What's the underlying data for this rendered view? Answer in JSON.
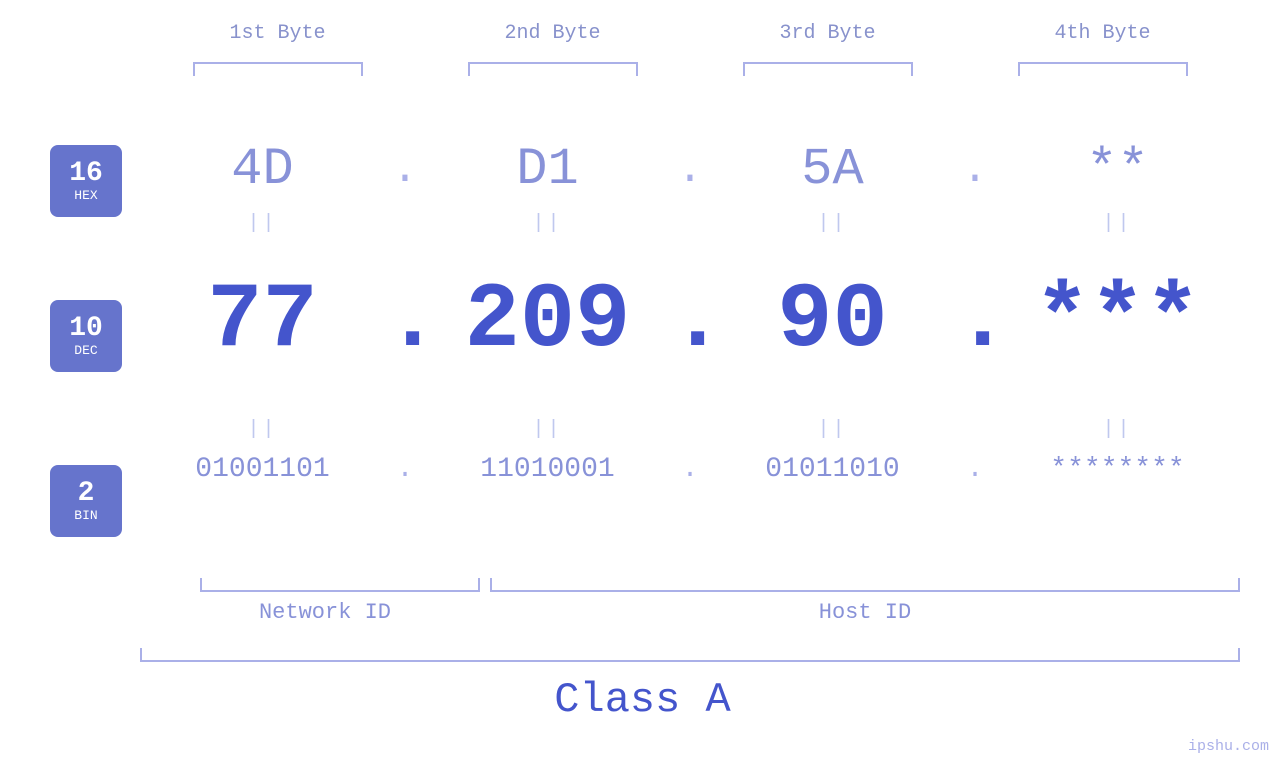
{
  "badges": {
    "hex": {
      "number": "16",
      "label": "HEX"
    },
    "dec": {
      "number": "10",
      "label": "DEC"
    },
    "bin": {
      "number": "2",
      "label": "BIN"
    }
  },
  "headers": {
    "byte1": "1st Byte",
    "byte2": "2nd Byte",
    "byte3": "3rd Byte",
    "byte4": "4th Byte"
  },
  "hex_row": {
    "b1": "4D",
    "b2": "D1",
    "b3": "5A",
    "b4": "**",
    "dot": "."
  },
  "dec_row": {
    "b1": "77",
    "b2": "209",
    "b3": "90",
    "b4": "***",
    "dot": "."
  },
  "bin_row": {
    "b1": "01001101",
    "b2": "11010001",
    "b3": "01011010",
    "b4": "********",
    "dot": "."
  },
  "labels": {
    "network_id": "Network ID",
    "host_id": "Host ID",
    "class": "Class A"
  },
  "watermark": "ipshu.com"
}
